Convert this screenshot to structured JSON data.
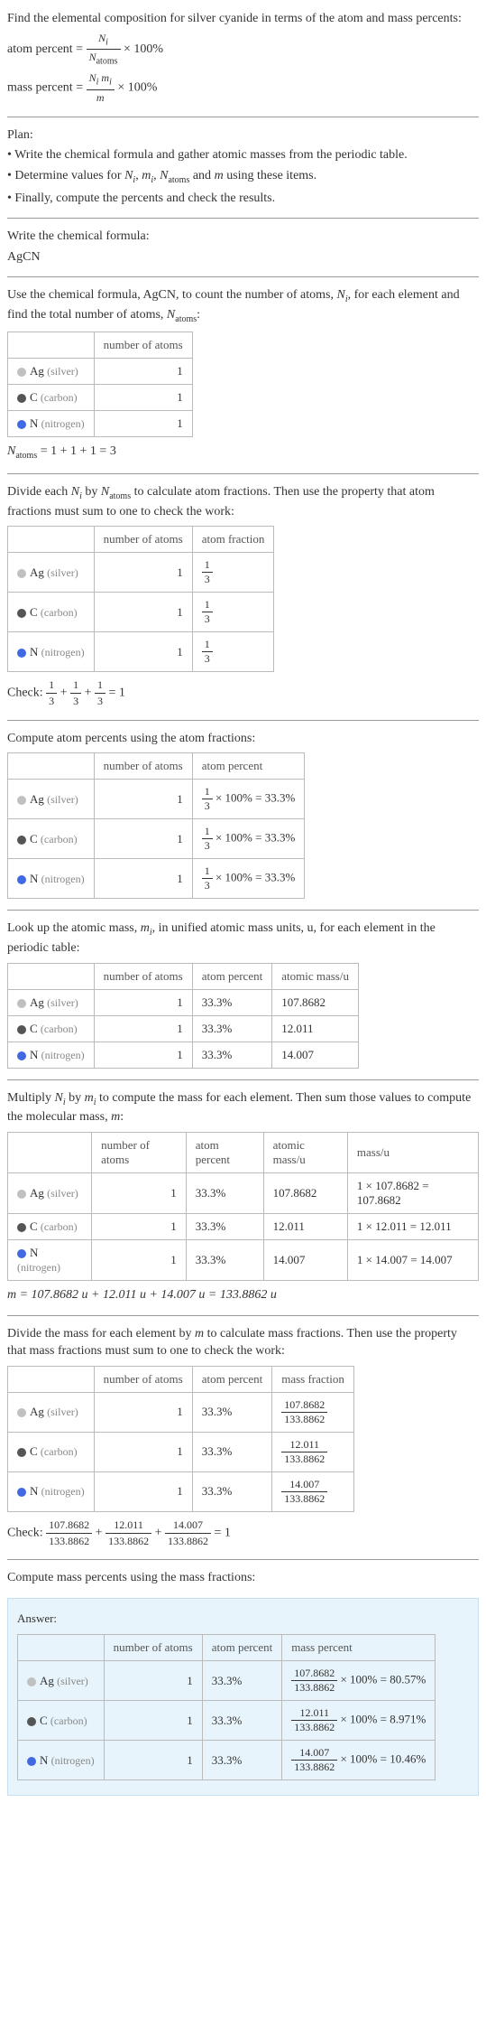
{
  "intro": {
    "line1": "Find the elemental composition for silver cyanide in terms of the atom and mass percents:",
    "atom_percent_lhs": "atom percent = ",
    "atom_percent_num": "N_i",
    "atom_percent_den": "N_atoms",
    "times100": " × 100%",
    "mass_percent_lhs": "mass percent = ",
    "mass_percent_num": "N_i m_i",
    "mass_percent_den": "m"
  },
  "plan": {
    "title": "Plan:",
    "b1": "• Write the chemical formula and gather atomic masses from the periodic table.",
    "b2_pre": "• Determine values for ",
    "b2_post": " using these items.",
    "b3": "• Finally, compute the percents and check the results."
  },
  "write_formula": {
    "title": "Write the chemical formula:",
    "formula": "AgCN"
  },
  "count_atoms": {
    "text_pre": "Use the chemical formula, AgCN, to count the number of atoms, ",
    "text_mid": ", for each element and find the total number of atoms, ",
    "text_post": ":",
    "header_natoms": "number of atoms",
    "ag_label": "Ag",
    "ag_paren": "(silver)",
    "ag_n": "1",
    "c_label": "C",
    "c_paren": "(carbon)",
    "c_n": "1",
    "n_label": "N",
    "n_paren": "(nitrogen)",
    "n_n": "1",
    "natoms_eq": " = 1 + 1 + 1 = 3"
  },
  "atom_frac": {
    "text": "Divide each N_i by N_atoms to calculate atom fractions. Then use the property that atom fractions must sum to one to check the work:",
    "h1": "number of atoms",
    "h2": "atom fraction",
    "ag_n": "1",
    "c_n": "1",
    "n_n": "1",
    "check_lhs": "Check: ",
    "check_rhs": " = 1"
  },
  "atom_pct": {
    "text": "Compute atom percents using the atom fractions:",
    "h1": "number of atoms",
    "h2": "atom percent",
    "ag_n": "1",
    "ag_p": " × 100% = 33.3%",
    "c_n": "1",
    "c_p": " × 100% = 33.3%",
    "n_n": "1",
    "n_p": " × 100% = 33.3%"
  },
  "atomic_mass": {
    "text_pre": "Look up the atomic mass, ",
    "text_post": ", in unified atomic mass units, u, for each element in the periodic table:",
    "h1": "number of atoms",
    "h2": "atom percent",
    "h3": "atomic mass/u",
    "ag": {
      "n": "1",
      "p": "33.3%",
      "m": "107.8682"
    },
    "c": {
      "n": "1",
      "p": "33.3%",
      "m": "12.011"
    },
    "n": {
      "n": "1",
      "p": "33.3%",
      "m": "14.007"
    }
  },
  "mass_each": {
    "text_pre": "Multiply ",
    "text_mid": " by ",
    "text_mid2": " to compute the mass for each element. Then sum those values to compute the molecular mass, ",
    "text_post": ":",
    "h1": "number of atoms",
    "h2": "atom percent",
    "h3": "atomic mass/u",
    "h4": "mass/u",
    "ag": {
      "n": "1",
      "p": "33.3%",
      "m": "107.8682",
      "mu": "1 × 107.8682 = 107.8682"
    },
    "c": {
      "n": "1",
      "p": "33.3%",
      "m": "12.011",
      "mu": "1 × 12.011 = 12.011"
    },
    "n": {
      "n": "1",
      "p": "33.3%",
      "m": "14.007",
      "mu": "1 × 14.007 = 14.007"
    },
    "m_eq": "m = 107.8682 u + 12.011 u + 14.007 u = 133.8862 u"
  },
  "mass_frac": {
    "text": "Divide the mass for each element by m to calculate mass fractions. Then use the property that mass fractions must sum to one to check the work:",
    "h1": "number of atoms",
    "h2": "atom percent",
    "h3": "mass fraction",
    "ag": {
      "n": "1",
      "p": "33.3%",
      "num": "107.8682",
      "den": "133.8862"
    },
    "c": {
      "n": "1",
      "p": "33.3%",
      "num": "12.011",
      "den": "133.8862"
    },
    "n": {
      "n": "1",
      "p": "33.3%",
      "num": "14.007",
      "den": "133.8862"
    },
    "check_lhs": "Check: ",
    "check_rhs": " = 1"
  },
  "mass_pct": {
    "text": "Compute mass percents using the mass fractions:"
  },
  "answer": {
    "title": "Answer:",
    "h1": "number of atoms",
    "h2": "atom percent",
    "h3": "mass percent",
    "ag": {
      "n": "1",
      "p": "33.3%",
      "num": "107.8682",
      "den": "133.8862",
      "res": " × 100% = 80.57%"
    },
    "c": {
      "n": "1",
      "p": "33.3%",
      "num": "12.011",
      "den": "133.8862",
      "res": " × 100% = 8.971%"
    },
    "n": {
      "n": "1",
      "p": "33.3%",
      "num": "14.007",
      "den": "133.8862",
      "res": " × 100% = 10.46%"
    }
  }
}
